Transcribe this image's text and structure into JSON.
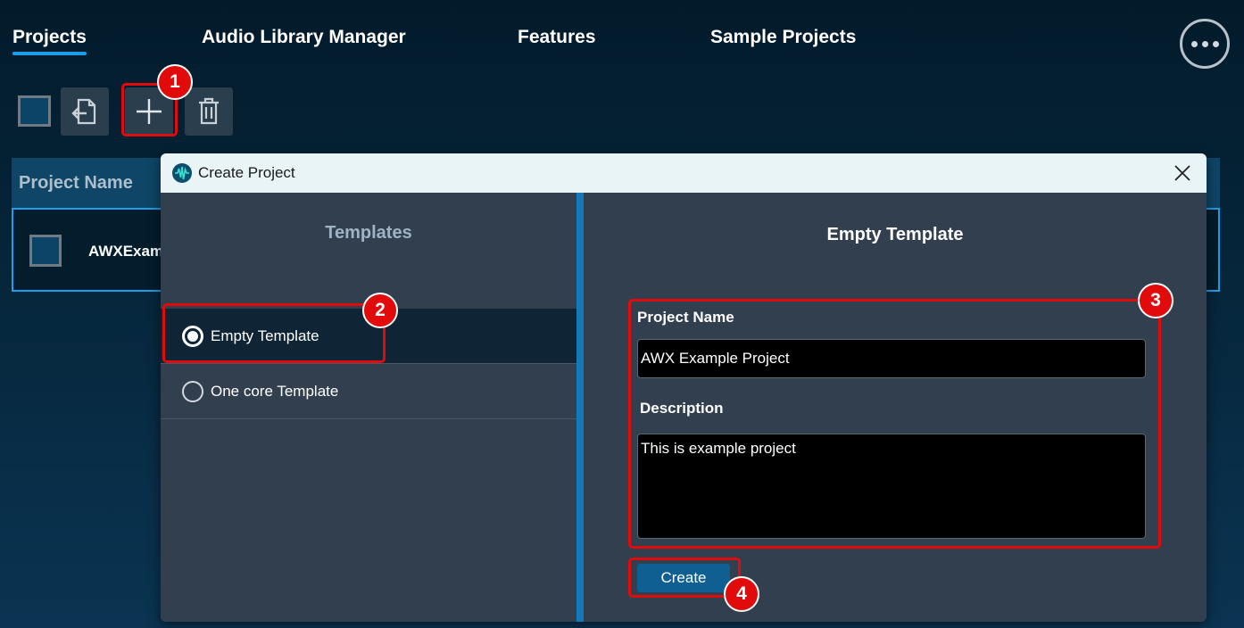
{
  "nav": {
    "tabs": [
      {
        "label": "Projects",
        "active": true
      },
      {
        "label": "Audio Library Manager",
        "active": false
      },
      {
        "label": "Features",
        "active": false
      },
      {
        "label": "Sample Projects",
        "active": false
      }
    ],
    "more_icon": "more-horizontal-icon"
  },
  "toolbar": {
    "icons": [
      "select-all-checkbox",
      "import-icon",
      "plus-icon",
      "trash-icon"
    ]
  },
  "table": {
    "header": "Project Name",
    "rows": [
      {
        "name": "AWXExam"
      }
    ]
  },
  "annotations": [
    "1",
    "2",
    "3",
    "4"
  ],
  "dialog": {
    "title": "Create Project",
    "templates_heading": "Templates",
    "templates": [
      {
        "label": "Empty Template",
        "selected": true
      },
      {
        "label": "One core Template",
        "selected": false
      }
    ],
    "selected_heading": "Empty Template",
    "project_name_label": "Project Name",
    "project_name_value": "AWX Example Project",
    "description_label": "Description",
    "description_value": "This is example project",
    "create_label": "Create"
  },
  "colors": {
    "accent": "#1e9ee8",
    "highlight": "#e10b0b",
    "dialog_bg": "#323f4f",
    "create_button": "#0f5f93"
  }
}
